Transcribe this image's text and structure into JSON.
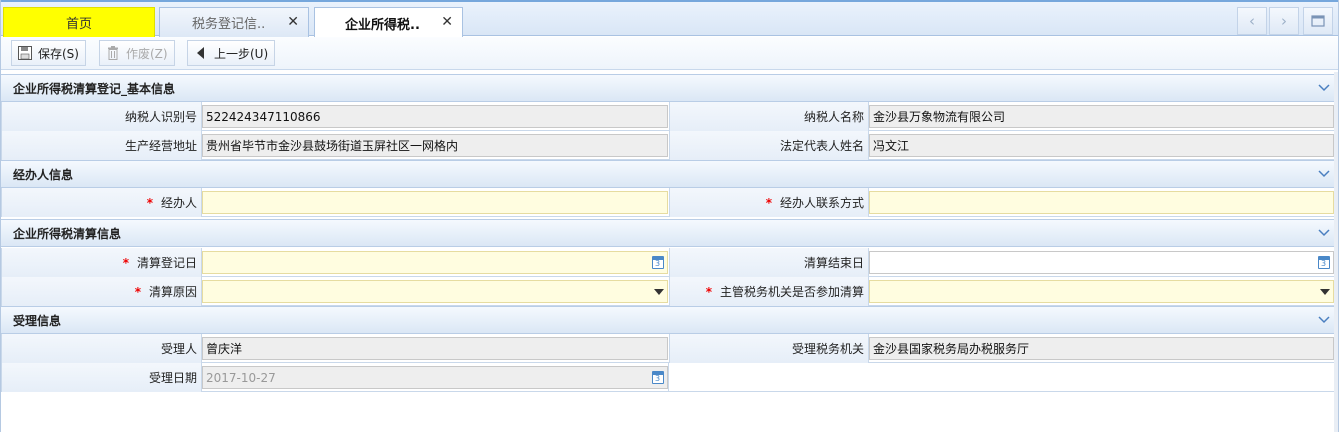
{
  "tabs": {
    "home": "首页",
    "tab2": "税务登记信..",
    "tab3": "企业所得税.."
  },
  "toolbar": {
    "save": "保存(S)",
    "void": "作废(Z)",
    "prev": "上一步(U)"
  },
  "sections": {
    "basic": "企业所得税清算登记_基本信息",
    "agent": "经办人信息",
    "liquidation": "企业所得税清算信息",
    "accept": "受理信息"
  },
  "basic": {
    "taxpayer_id_label": "纳税人识别号",
    "taxpayer_id": "522424347110866",
    "taxpayer_name_label": "纳税人名称",
    "taxpayer_name": "金沙县万象物流有限公司",
    "address_label": "生产经营地址",
    "address": "贵州省毕节市金沙县鼓场街道玉屏社区一网格内",
    "legal_rep_label": "法定代表人姓名",
    "legal_rep": "冯文江"
  },
  "agent": {
    "agent_label": "经办人",
    "agent_value": "",
    "contact_label": "经办人联系方式",
    "contact_value": ""
  },
  "liquidation": {
    "reg_date_label": "清算登记日",
    "reg_date": "",
    "end_date_label": "清算结束日",
    "end_date": "",
    "reason_label": "清算原因",
    "reason": "",
    "authority_label": "主管税务机关是否参加清算",
    "authority": ""
  },
  "accept": {
    "acceptor_label": "受理人",
    "acceptor": "曾庆洋",
    "office_label": "受理税务机关",
    "office": "金沙县国家税务局办税服务厅",
    "date_label": "受理日期",
    "date": "2017-10-27"
  },
  "required_mark": "*",
  "colors": {
    "home_tab": "#ffff00",
    "section_bg": "#dbe7f5",
    "editable_bg": "#fffde0",
    "readonly_bg": "#eeeeee",
    "required": "#e00000"
  }
}
